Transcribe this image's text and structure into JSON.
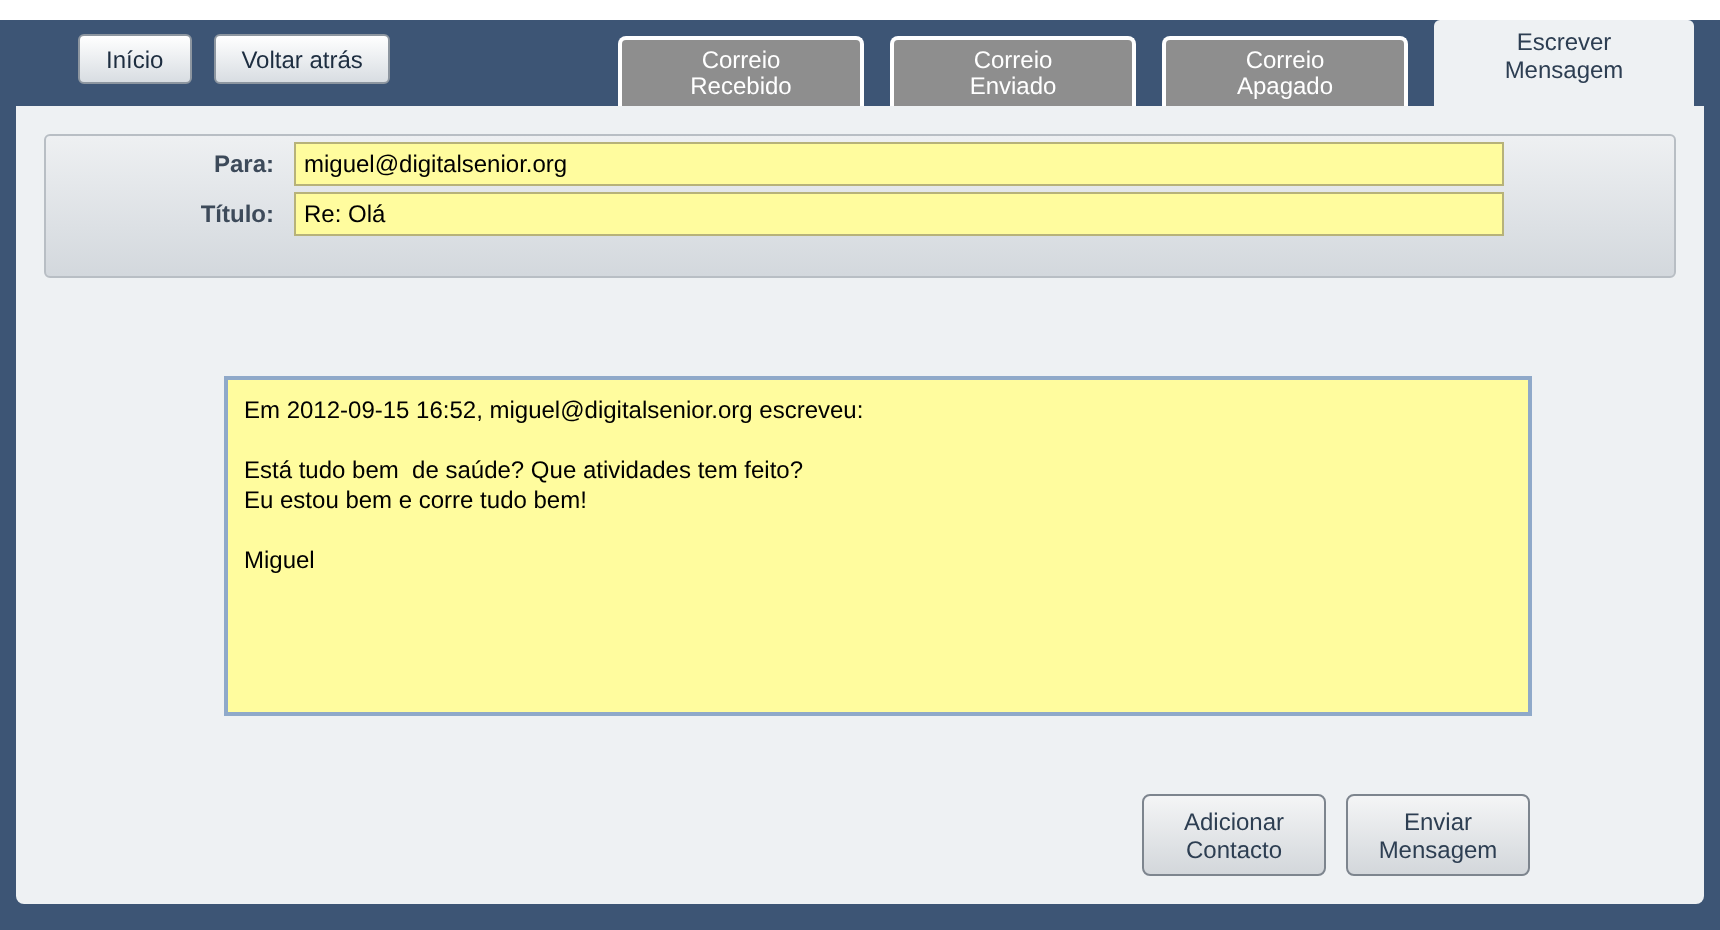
{
  "nav_buttons": [
    "Início",
    "Voltar atrás"
  ],
  "tabs": [
    {
      "label": "Correio\nRecebido",
      "selected": false
    },
    {
      "label": "Correio\nEnviado",
      "selected": false
    },
    {
      "label": "Correio\nApagado",
      "selected": false
    },
    {
      "label": "Escrever\nMensagem",
      "selected": true
    }
  ],
  "header_fields": [
    {
      "label": "Para:",
      "value": "miguel@digitalsenior.org"
    },
    {
      "label": "Título:",
      "value": "Re: Olá"
    }
  ],
  "message_body": "Em 2012-09-15 16:52, miguel@digitalsenior.org escreveu:\n\nEstá tudo bem  de saúde? Que atividades tem feito?\nEu estou bem e corre tudo bem!\n\nMiguel",
  "action_buttons": [
    "Adicionar\nContacto",
    "Enviar\nMensagem"
  ]
}
